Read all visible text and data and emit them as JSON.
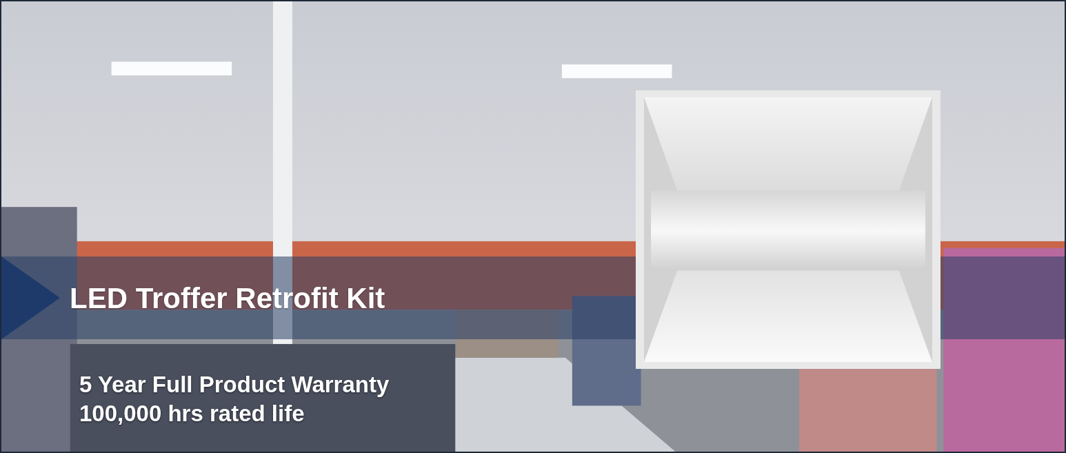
{
  "banner": {
    "title": "LED Troffer Retrofit Kit",
    "features": [
      "5 Year Full Product Warranty",
      "100,000 hrs rated life"
    ]
  }
}
